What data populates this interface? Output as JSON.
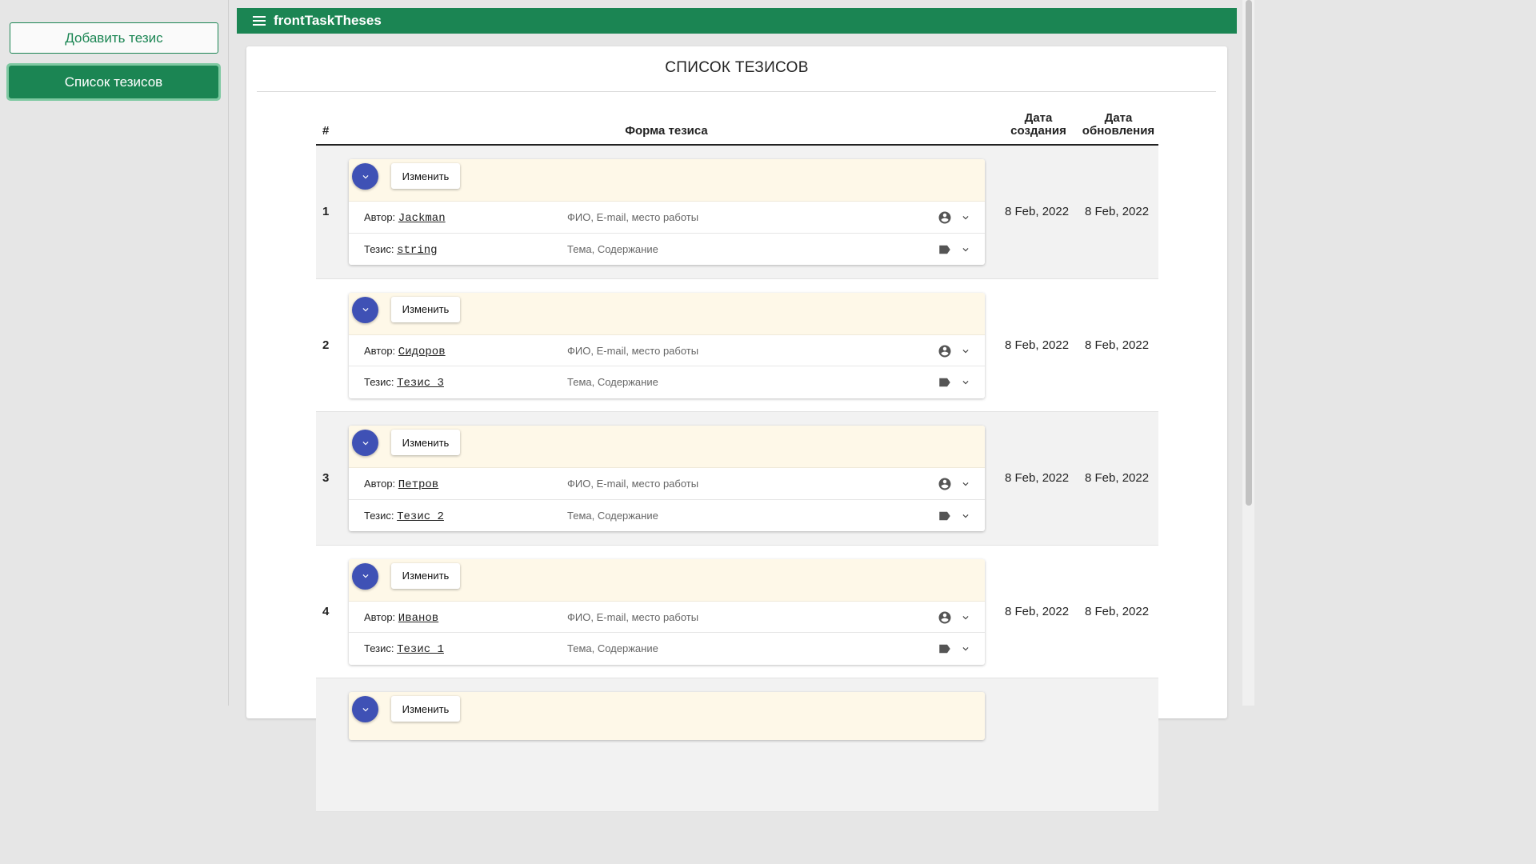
{
  "sidebar": {
    "add_label": "Добавить тезис",
    "list_label": "Список тезисов"
  },
  "topbar": {
    "title": "frontTaskTheses"
  },
  "page": {
    "title": "СПИСОК ТЕЗИСОВ"
  },
  "table": {
    "headers": {
      "num": "#",
      "form": "Форма тезиса",
      "created": "Дата создания",
      "updated": "Дата обновления"
    },
    "edit_label": "Изменить",
    "author_prefix": "Автор:",
    "thesis_prefix": "Тезис:",
    "author_hint": "ФИО, E-mail, место работы",
    "thesis_hint": "Тема, Содержание",
    "rows": [
      {
        "num": "1",
        "author": "Jackman",
        "thesis": "string",
        "created": "8 Feb, 2022",
        "updated": "8 Feb, 2022"
      },
      {
        "num": "2",
        "author": "Сидоров",
        "thesis": "Тезис 3",
        "created": "8 Feb, 2022",
        "updated": "8 Feb, 2022"
      },
      {
        "num": "3",
        "author": "Петров",
        "thesis": "Тезис 2",
        "created": "8 Feb, 2022",
        "updated": "8 Feb, 2022"
      },
      {
        "num": "4",
        "author": "Иванов",
        "thesis": "Тезис 1",
        "created": "8 Feb, 2022",
        "updated": "8 Feb, 2022"
      }
    ]
  },
  "colors": {
    "primary": "#1b8553",
    "accent": "#3f51b5",
    "thesis_header_bg": "#fef8e8"
  },
  "icons": {
    "menu": "hamburger-menu-icon",
    "expand": "chevron-down-icon",
    "author": "account-circle-icon",
    "thesis": "label-icon"
  }
}
